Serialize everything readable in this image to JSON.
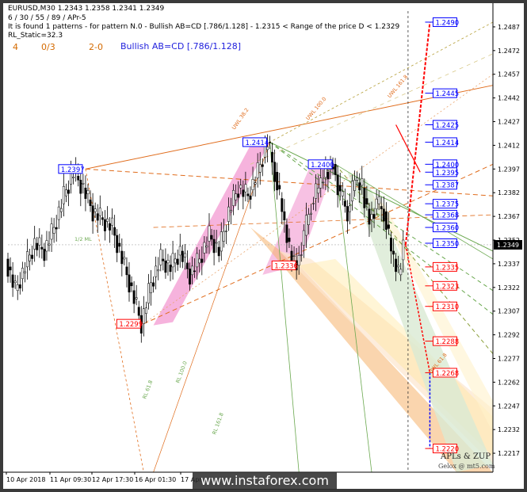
{
  "header": {
    "symbol_line": "EURUSD,M30  1.2343 1.2358 1.2341 1.2349",
    "params_line": "6 / 30 / 55 / 89 / APr-5",
    "found_line": "It is found 1 patterns  -  for pattern N.0 - Bullish AB=CD [.786/1.128] - 1.2315 < Range of the price D < 1.2329",
    "rl_line": "RL_Static=32.3",
    "stat_a": "4",
    "stat_b": "0/3",
    "stat_c": "2-0",
    "pattern_name": "Bullish AB=CD [.786/1.128]"
  },
  "branding": {
    "name": "APLs & ZUP",
    "sub": "Gelox @ mt5.com"
  },
  "watermark": "www.instaforex.com",
  "colors": {
    "blue_box": "#0000ff",
    "red_box": "#ff0000",
    "orange": "#e8803a",
    "green": "#6aa84f",
    "pink": "#f4a6d7"
  },
  "chart_data": {
    "type": "candlestick",
    "symbol": "EURUSD",
    "timeframe": "M30",
    "current_price": 1.2349,
    "ylim": [
      1.2205,
      1.2497
    ],
    "y_ticks": [
      "1.2487",
      "1.2472",
      "1.2457",
      "1.2442",
      "1.2427",
      "1.2412",
      "1.2397",
      "1.2382",
      "1.2367",
      "1.2352",
      "1.2337",
      "1.2322",
      "1.2307",
      "1.2292",
      "1.2277",
      "1.2262",
      "1.2247",
      "1.2232",
      "1.2217"
    ],
    "x_ticks": [
      "10 Apr 2018",
      "11 Apr 09:30",
      "12 Apr 17:30",
      "16 Apr 01:30",
      "17 Apr"
    ],
    "price_path": [
      [
        0,
        1.234
      ],
      [
        4,
        1.232
      ],
      [
        8,
        1.2335
      ],
      [
        12,
        1.235
      ],
      [
        16,
        1.2345
      ],
      [
        20,
        1.236
      ],
      [
        24,
        1.238
      ],
      [
        28,
        1.2395
      ],
      [
        32,
        1.2385
      ],
      [
        36,
        1.237
      ],
      [
        40,
        1.2365
      ],
      [
        44,
        1.236
      ],
      [
        48,
        1.234
      ],
      [
        52,
        1.232
      ],
      [
        56,
        1.2299
      ],
      [
        60,
        1.2325
      ],
      [
        64,
        1.234
      ],
      [
        68,
        1.2335
      ],
      [
        72,
        1.2345
      ],
      [
        76,
        1.233
      ],
      [
        80,
        1.234
      ],
      [
        84,
        1.2355
      ],
      [
        88,
        1.2345
      ],
      [
        92,
        1.237
      ],
      [
        96,
        1.2385
      ],
      [
        100,
        1.238
      ],
      [
        104,
        1.2395
      ],
      [
        108,
        1.2414
      ],
      [
        111,
        1.2395
      ],
      [
        114,
        1.237
      ],
      [
        117,
        1.2345
      ],
      [
        120,
        1.2336
      ],
      [
        123,
        1.2355
      ],
      [
        126,
        1.2375
      ],
      [
        129,
        1.2385
      ],
      [
        132,
        1.2395
      ],
      [
        135,
        1.24
      ],
      [
        138,
        1.238
      ],
      [
        141,
        1.237
      ],
      [
        144,
        1.239
      ],
      [
        147,
        1.2385
      ],
      [
        150,
        1.2365
      ],
      [
        153,
        1.2375
      ],
      [
        156,
        1.237
      ],
      [
        159,
        1.2345
      ],
      [
        162,
        1.233
      ],
      [
        164,
        1.2349
      ]
    ],
    "price_levels": [
      {
        "label": "1.2490",
        "color": "blue",
        "x": 174
      },
      {
        "label": "1.2445",
        "color": "blue",
        "x": 174
      },
      {
        "label": "1.2425",
        "color": "blue",
        "x": 174
      },
      {
        "label": "1.2414",
        "color": "blue",
        "x": 174
      },
      {
        "label": "1.2400",
        "color": "blue",
        "x": 174
      },
      {
        "label": "1.2395",
        "color": "blue",
        "x": 174
      },
      {
        "label": "1.2387",
        "color": "blue",
        "x": 174
      },
      {
        "label": "1.2375",
        "color": "blue",
        "x": 174
      },
      {
        "label": "1.2368",
        "color": "blue",
        "x": 174
      },
      {
        "label": "1.2360",
        "color": "blue",
        "x": 174
      },
      {
        "label": "1.2350",
        "color": "blue",
        "x": 174
      },
      {
        "label": "1.2335",
        "color": "red",
        "x": 174
      },
      {
        "label": "1.2323",
        "color": "red",
        "x": 174
      },
      {
        "label": "1.2310",
        "color": "red",
        "x": 174
      },
      {
        "label": "1.2288",
        "color": "red",
        "x": 174
      },
      {
        "label": "1.2268",
        "color": "red",
        "x": 174
      },
      {
        "label": "1.2220",
        "color": "red",
        "x": 174
      }
    ],
    "pivots": [
      {
        "label": "1.2397",
        "color": "blue",
        "x": 32
      },
      {
        "label": "1.2414",
        "color": "blue",
        "x": 108
      },
      {
        "label": "1.2400",
        "color": "blue",
        "x": 135
      },
      {
        "label": "1.2299",
        "color": "red",
        "x": 56
      },
      {
        "label": "1.2336",
        "color": "red",
        "x": 120
      }
    ],
    "fib_labels": [
      "UWL 161.8",
      "UWL 100.0",
      "UWL 38.2",
      "UWL 61.8",
      "RL 61.8",
      "RL 100.0",
      "RL 161.8",
      "1/2 ML"
    ]
  }
}
